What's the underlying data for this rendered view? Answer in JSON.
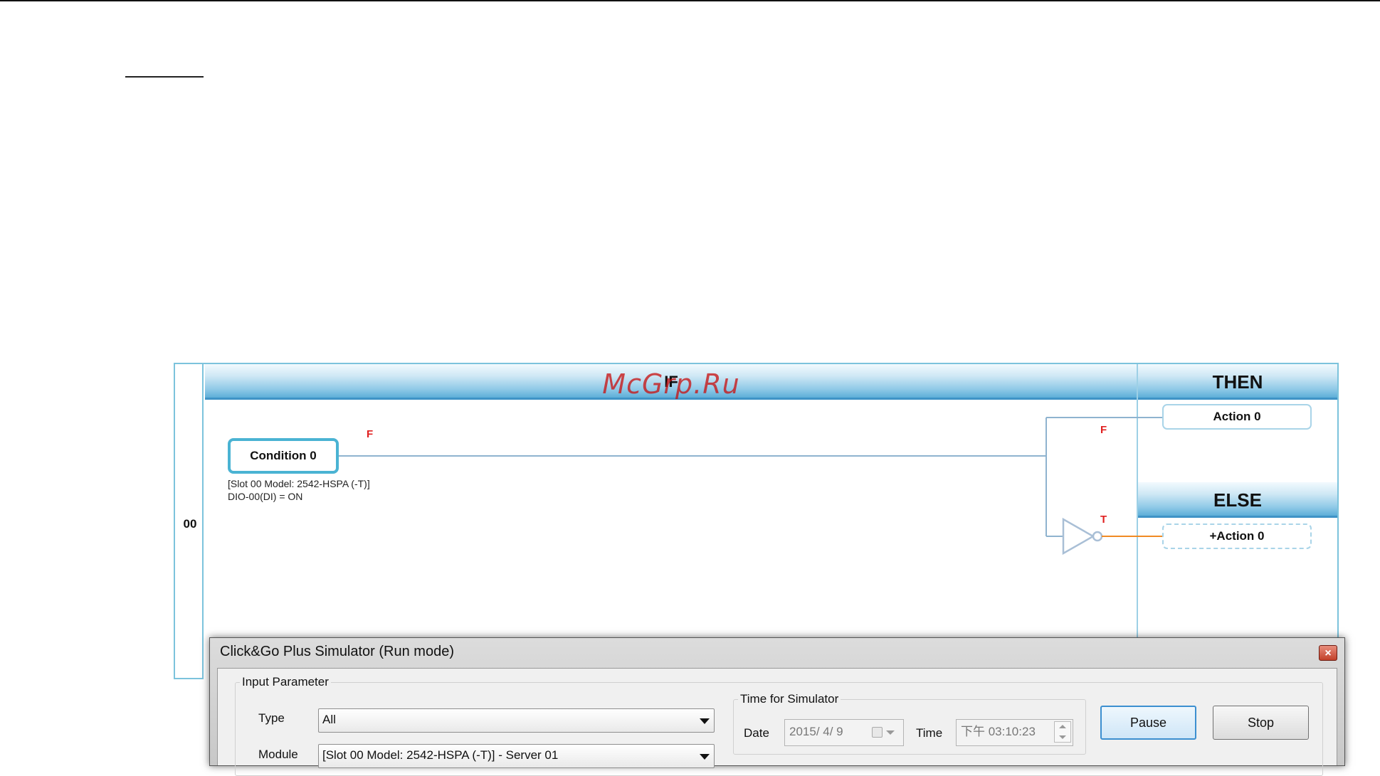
{
  "watermark": "McGrp.Ru",
  "ladder": {
    "rung_number": "00",
    "if_label": "IF",
    "then_label": "THEN",
    "else_label": "ELSE",
    "condition": {
      "label": "Condition 0",
      "state_flag": "F",
      "description_line1": "[Slot 00 Model: 2542-HSPA (-T)]",
      "description_line2": "DIO-00(DI) = ON"
    },
    "then_branch": {
      "flag": "F",
      "action_label": "Action 0"
    },
    "else_branch": {
      "flag": "T",
      "action_label": "+Action 0"
    },
    "colors": {
      "frame": "#7cc3dc",
      "wire": "#8fb3cf",
      "active_wire": "#f08a24",
      "flag": "#e02020"
    }
  },
  "simulator": {
    "title": "Click&Go Plus Simulator (Run mode)",
    "close_glyph": "×",
    "input_parameter": {
      "legend": "Input Parameter",
      "type_label": "Type",
      "type_value": "All",
      "module_label": "Module",
      "module_value": "[Slot 00 Model: 2542-HSPA (-T)] - Server 01"
    },
    "time_for_simulator": {
      "legend": "Time for Simulator",
      "date_label": "Date",
      "date_value": "2015/ 4/ 9",
      "time_label": "Time",
      "time_value": "下午 03:10:23"
    },
    "buttons": {
      "pause": "Pause",
      "stop": "Stop"
    }
  }
}
